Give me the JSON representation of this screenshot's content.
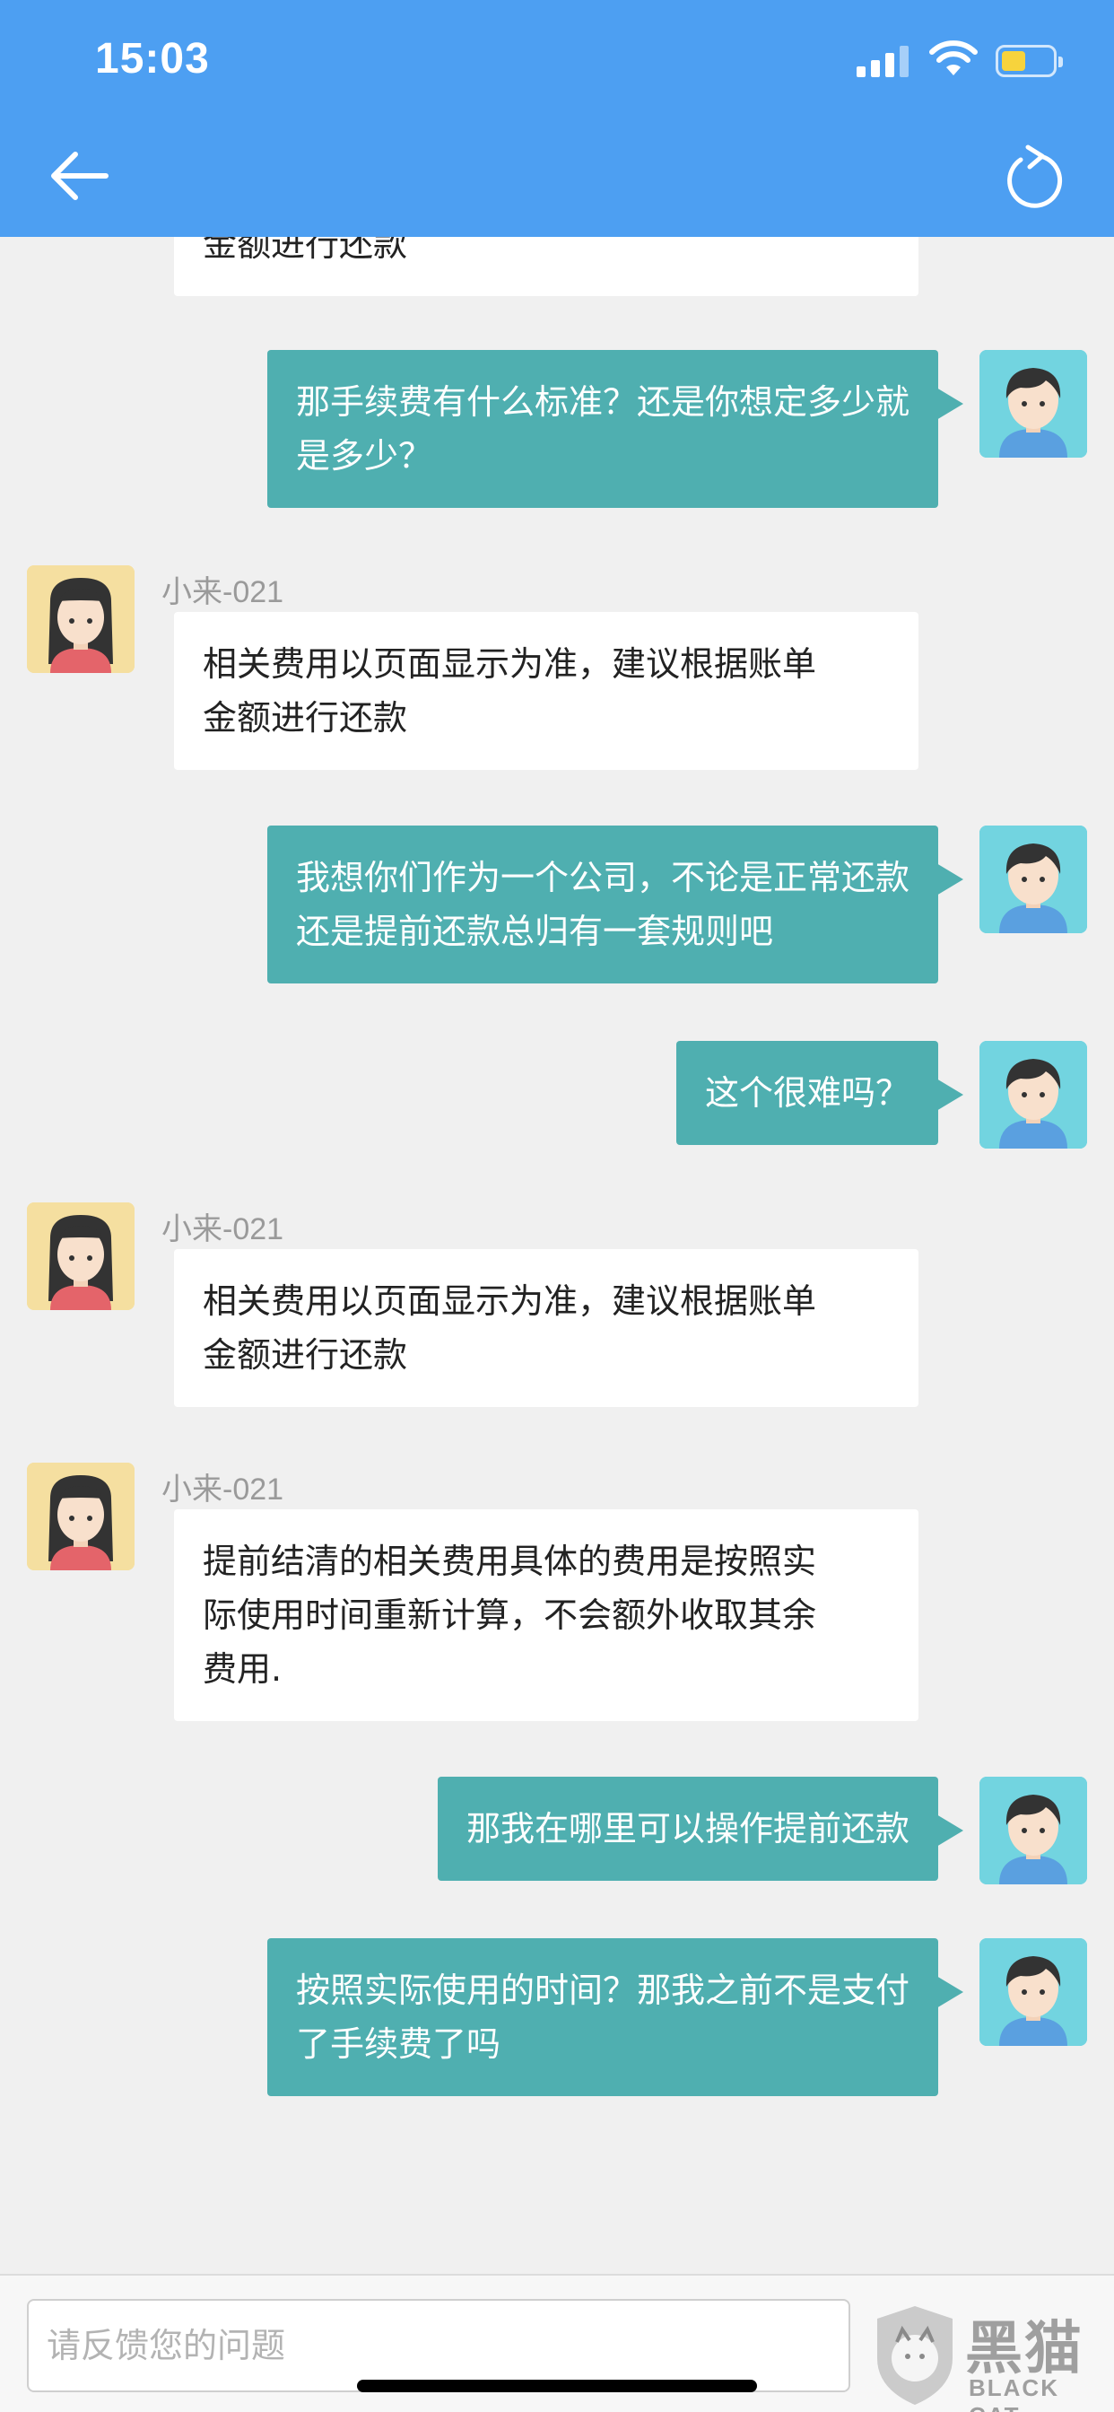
{
  "status_bar": {
    "time": "15:03"
  },
  "header": {
    "back_icon": "arrow-left-icon",
    "refresh_icon": "refresh-icon",
    "accent": "#4d9ff2"
  },
  "chat": {
    "partial_top_text": "金额进行还款",
    "messages": [
      {
        "from": "user",
        "text": "那手续费有什么标准？还是你想定多少就\n是多少？"
      },
      {
        "from": "agent",
        "sender": "小来-021",
        "text": "相关费用以页面显示为准，建议根据账单\n金额进行还款"
      },
      {
        "from": "user",
        "text": "我想你们作为一个公司，不论是正常还款\n还是提前还款总归有一套规则吧"
      },
      {
        "from": "user",
        "text": "这个很难吗？"
      },
      {
        "from": "agent",
        "sender": "小来-021",
        "text": "相关费用以页面显示为准，建议根据账单\n金额进行还款"
      },
      {
        "from": "agent",
        "sender": "小来-021",
        "text": "提前结清的相关费用具体的费用是按照实\n际使用时间重新计算，不会额外收取其余\n费用."
      },
      {
        "from": "user",
        "text": "那我在哪里可以操作提前还款"
      },
      {
        "from": "user",
        "text": "按照实际使用的时间？那我之前不是支付\n了手续费了吗"
      }
    ],
    "user_bubble_color": "#4fafb0",
    "agent_bubble_color": "#ffffff"
  },
  "input": {
    "placeholder": "请反馈您的问题"
  },
  "watermark": {
    "cn": "黑猫",
    "en": "BLACK CAT"
  }
}
